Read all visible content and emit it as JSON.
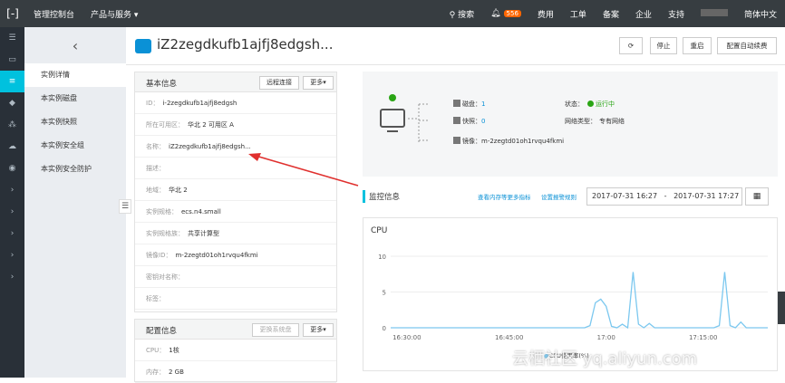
{
  "topbar": {
    "console": "管理控制台",
    "products": "产品与服务 ▾",
    "search": "搜索",
    "badge": "556",
    "fee": "费用",
    "ticket": "工单",
    "beian": "备案",
    "enterprise": "企业",
    "support": "支持",
    "lang": "简体中文"
  },
  "subnav": {
    "items": [
      "实例详情",
      "本实例磁盘",
      "本实例快照",
      "本实例安全组",
      "本实例安全防护"
    ]
  },
  "header": {
    "title": "iZ2zegdkufb1ajfj8edgsh...",
    "stop": "停止",
    "restart": "重启",
    "config": "配置自动续费"
  },
  "basic": {
    "title": "基本信息",
    "remote": "远程连接",
    "more": "更多▾",
    "rows": [
      {
        "label": "ID：",
        "value": "i-2zegdkufb1ajfj8edgsh"
      },
      {
        "label": "所在可用区：",
        "value": "华北 2 可用区 A"
      },
      {
        "label": "名称：",
        "value": "iZ2zegdkufb1ajfj8edgsh..."
      },
      {
        "label": "描述：",
        "value": ""
      },
      {
        "label": "地域：",
        "value": "华北 2"
      },
      {
        "label": "实例规格：",
        "value": "ecs.n4.small"
      },
      {
        "label": "实例规格族：",
        "value": "共享计算型"
      },
      {
        "label": "镜像ID：",
        "value": "m-2zegtd01oh1rvqu4fkmi"
      },
      {
        "label": "密钥对名称：",
        "value": ""
      },
      {
        "label": "标签：",
        "value": ""
      }
    ]
  },
  "config": {
    "title": "配置信息",
    "change": "更换系统盘",
    "more": "更多▾",
    "rows": [
      {
        "label": "CPU：",
        "value": "1核"
      },
      {
        "label": "内存：",
        "value": "2 GB"
      }
    ]
  },
  "overview": {
    "disk_label": "磁盘：",
    "disk_value": "1",
    "snap_label": "快照：",
    "snap_value": "0",
    "image_label": "镜像：",
    "image_value": "m-2zegtd01oh1rvqu4fkmi",
    "status_label": "状态：",
    "status_value": "运行中",
    "net_label": "网络类型：",
    "net_value": "专有网络"
  },
  "monitor": {
    "title": "监控信息",
    "link1": "查看内存等更多指标",
    "link2": "设置报警规则",
    "range_from": "2017-07-31 16:27",
    "range_sep": "-",
    "range_to": "2017-07-31 17:27"
  },
  "colors": {
    "accent": "#00c1de",
    "line": "#7cc8ef",
    "run": "#2aa515"
  },
  "chart_data": {
    "type": "line",
    "title": "CPU",
    "x": [
      "16:30:00",
      "16:45:00",
      "17:00",
      "17:15:00"
    ],
    "ylim": [
      0,
      10
    ],
    "yticks": [
      0,
      5,
      10
    ],
    "legend": "CPU使用率(%)",
    "series": [
      {
        "name": "CPU使用率(%)",
        "points": [
          [
            0,
            0
          ],
          [
            36,
            0
          ],
          [
            37,
            0.3
          ],
          [
            38,
            3.5
          ],
          [
            39,
            4
          ],
          [
            40,
            3
          ],
          [
            41,
            0.2
          ],
          [
            42,
            0
          ],
          [
            43,
            0.5
          ],
          [
            44,
            0
          ],
          [
            45,
            7.8
          ],
          [
            46,
            0.5
          ],
          [
            47,
            0
          ],
          [
            48,
            0.6
          ],
          [
            49,
            0
          ],
          [
            60,
            0
          ],
          [
            61,
            0.3
          ],
          [
            62,
            7.8
          ],
          [
            63,
            0.3
          ],
          [
            64,
            0
          ],
          [
            65,
            0.8
          ],
          [
            66,
            0
          ],
          [
            70,
            0
          ]
        ]
      }
    ]
  }
}
